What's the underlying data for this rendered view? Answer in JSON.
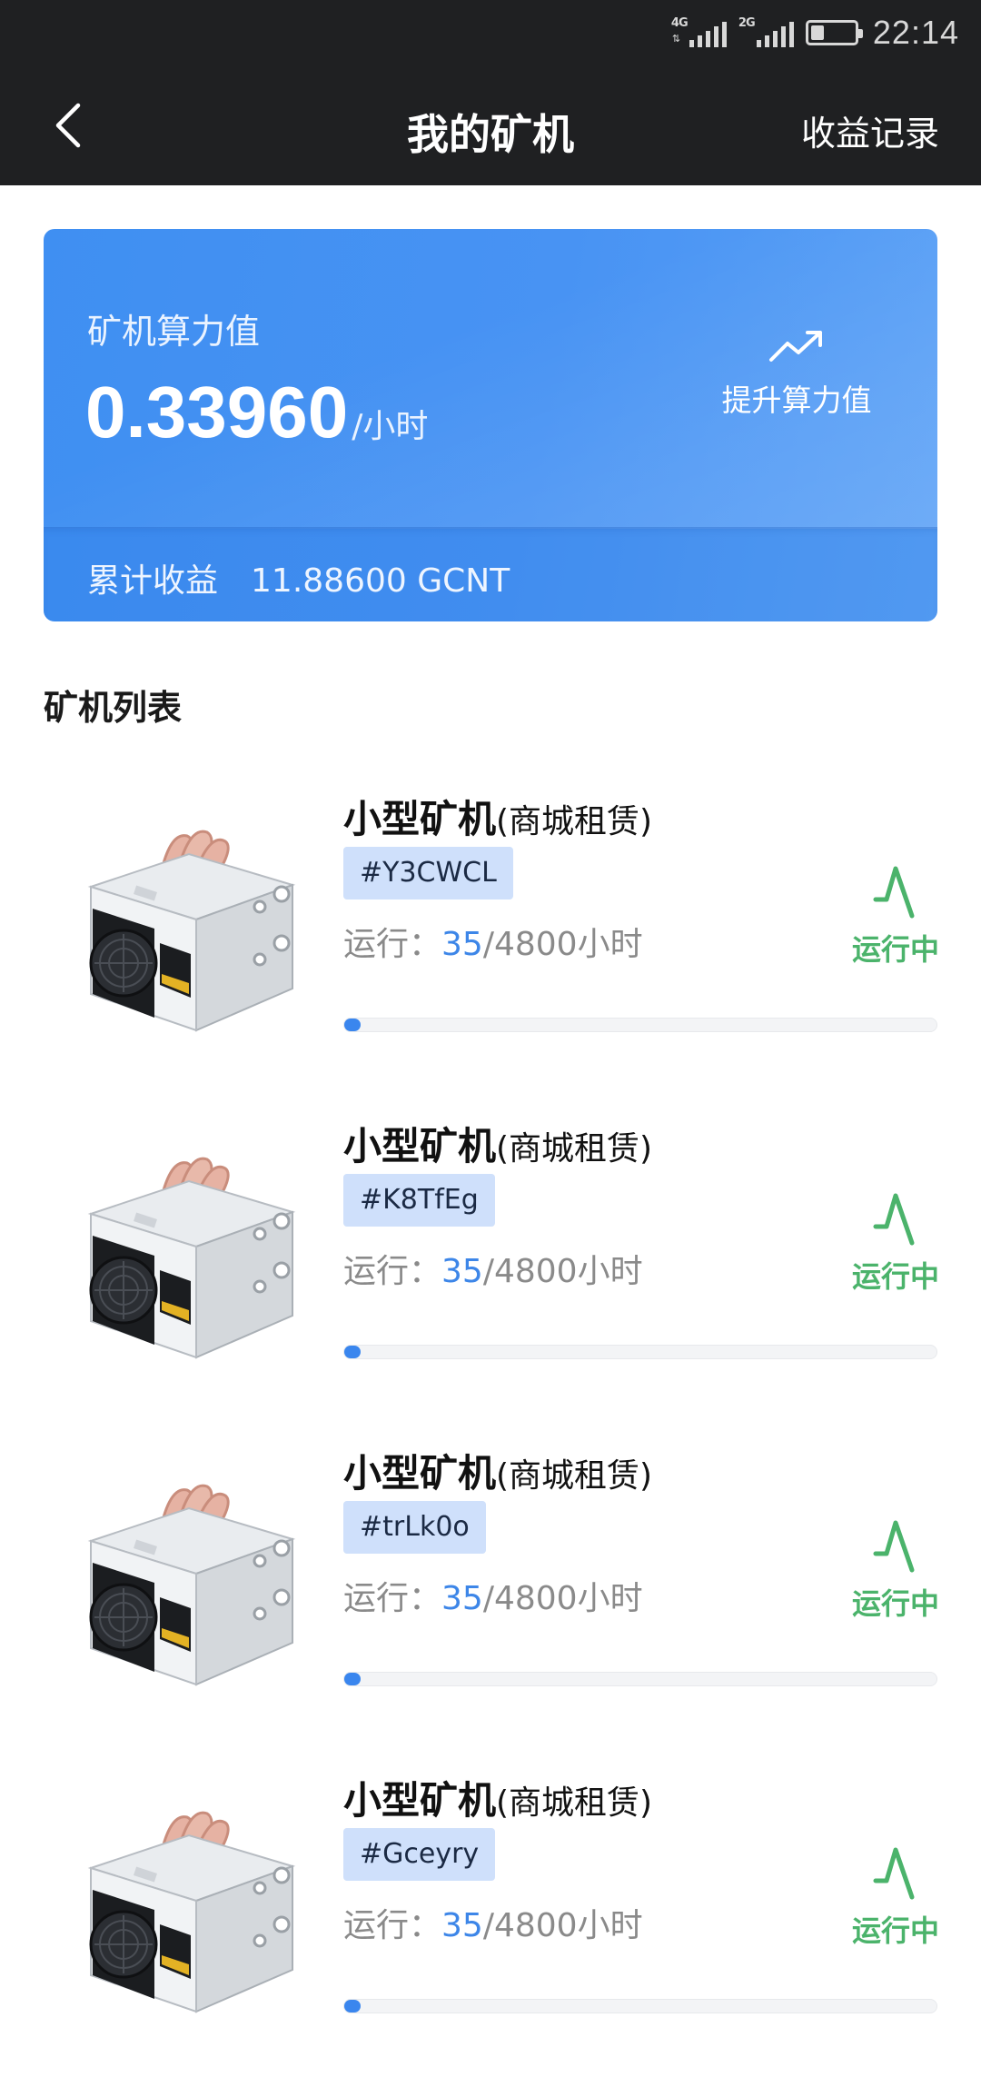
{
  "status_bar": {
    "network_1": "4G",
    "network_2": "2G",
    "battery_level": 0.3,
    "time": "22:14"
  },
  "header": {
    "back_icon": "chevron-left-icon",
    "title": "我的矿机",
    "records_label": "收益记录"
  },
  "summary": {
    "hashrate_label": "矿机算力值",
    "hashrate_value": "0.33960",
    "hashrate_unit": "/小时",
    "boost_icon": "trending-up-icon",
    "boost_label": "提升算力值",
    "earnings_label": "累计收益",
    "earnings_value": "11.88600 GCNT"
  },
  "colors": {
    "header_bg": "#1f2022",
    "card_blue": "#4893f3",
    "running_green": "#4bb36b",
    "accent_blue": "#3a86ee"
  },
  "list": {
    "title": "矿机列表",
    "items": [
      {
        "name": "小型矿机",
        "source": "(商城租赁)",
        "code": "#Y3CWCL",
        "run_label": "运行：",
        "run_done": "35",
        "run_total": "/4800小时",
        "progress": 0.0073,
        "status_icon": "running-pulse-icon",
        "status": "运行中"
      },
      {
        "name": "小型矿机",
        "source": "(商城租赁)",
        "code": "#K8TfEg",
        "run_label": "运行：",
        "run_done": "35",
        "run_total": "/4800小时",
        "progress": 0.0073,
        "status_icon": "running-pulse-icon",
        "status": "运行中"
      },
      {
        "name": "小型矿机",
        "source": "(商城租赁)",
        "code": "#trLk0o",
        "run_label": "运行：",
        "run_done": "35",
        "run_total": "/4800小时",
        "progress": 0.0073,
        "status_icon": "running-pulse-icon",
        "status": "运行中"
      },
      {
        "name": "小型矿机",
        "source": "(商城租赁)",
        "code": "#Gceyry",
        "run_label": "运行：",
        "run_done": "35",
        "run_total": "/4800小时",
        "progress": 0.0073,
        "status_icon": "running-pulse-icon",
        "status": "运行中"
      }
    ]
  }
}
